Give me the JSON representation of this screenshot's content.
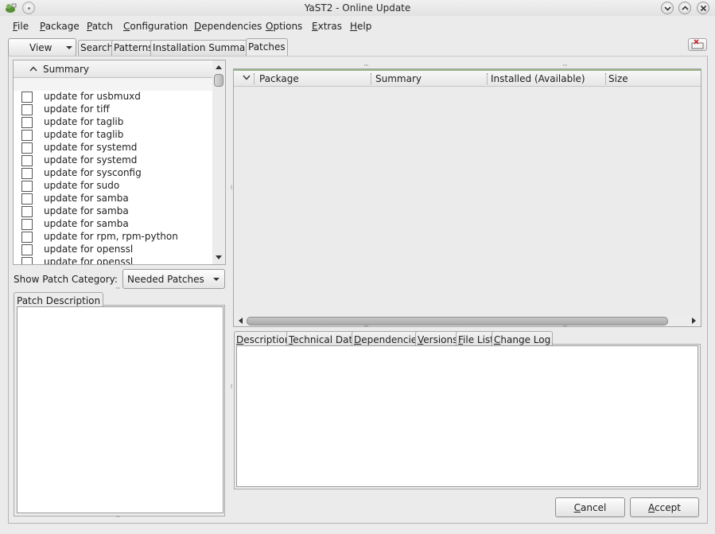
{
  "window": {
    "title": "YaST2 - Online Update"
  },
  "menu": [
    {
      "label": "File"
    },
    {
      "label": "Package"
    },
    {
      "label": "Patch"
    },
    {
      "label": "Configuration"
    },
    {
      "label": "Dependencies"
    },
    {
      "label": "Options"
    },
    {
      "label": "Extras"
    },
    {
      "label": "Help"
    }
  ],
  "toolbar": {
    "view_label": "View",
    "tabs": [
      "Search",
      "Patterns",
      "Installation Summary",
      "Patches"
    ],
    "active_tab": "Patches"
  },
  "patch_list": {
    "column": "Summary",
    "rows": [
      "update for usbmuxd",
      "update for tiff",
      "update for taglib",
      "update for taglib",
      "update for systemd",
      "update for systemd",
      "update for sysconfig",
      "update for sudo",
      "update for samba",
      "update for samba",
      "update for samba",
      "update for rpm, rpm-python",
      "update for openssl",
      "update for openssl"
    ]
  },
  "category": {
    "label": "Show Patch Category:",
    "selected": "Needed Patches"
  },
  "patch_description": {
    "tab": "Patch Description"
  },
  "package_table": {
    "columns": [
      "Package",
      "Summary",
      "Installed (Available)",
      "Size"
    ]
  },
  "detail_tabs": [
    "Description",
    "Technical Data",
    "Dependencies",
    "Versions",
    "File List",
    "Change Log"
  ],
  "buttons": {
    "cancel": "Cancel",
    "accept": "Accept"
  },
  "colors": {
    "header_accent": "#9bb38a",
    "background": "#ebebeb"
  }
}
